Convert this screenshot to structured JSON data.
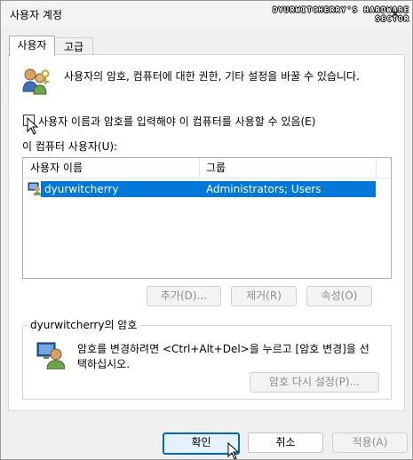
{
  "window": {
    "title": "사용자 계정",
    "watermark": "DYURWITCHERRY'S HARDWARE SECTOR",
    "close_glyph": "✕"
  },
  "tabs": [
    {
      "label": "사용자",
      "active": true
    },
    {
      "label": "고급",
      "active": false
    }
  ],
  "users_panel": {
    "intro_text": "사용자의 암호, 컴퓨터에 대한 권한, 기타 설정을 바꿀 수 있습니다.",
    "require_login_checkbox": {
      "label": "사용자 이름과 암호를 입력해야 이 컴퓨터를 사용할 수 있음(E)",
      "checked": false
    },
    "users_list_label": "이 컴퓨터 사용자(U):",
    "columns": [
      "사용자 이름",
      "그룹"
    ],
    "rows": [
      {
        "username": "dyurwitcherry",
        "groups": "Administrators; Users",
        "selected": true
      }
    ],
    "buttons": {
      "add": "추가(D)...",
      "remove": "제거(R)",
      "properties": "속성(O)"
    }
  },
  "password_group": {
    "title": "dyurwitcherry의 암호",
    "description_line1": "암호를 변경하려면 <Ctrl+Alt+Del>을 누르고 [암호 변경]을 선",
    "description_line2": "택하십시오.",
    "reset_button": "암호 다시 설정(P)..."
  },
  "footer": {
    "ok": "확인",
    "cancel": "취소",
    "apply": "적용(A)"
  },
  "colors": {
    "selection": "#0078d7",
    "accent_border": "#0067c0",
    "disabled_text": "#8d8d8d"
  }
}
